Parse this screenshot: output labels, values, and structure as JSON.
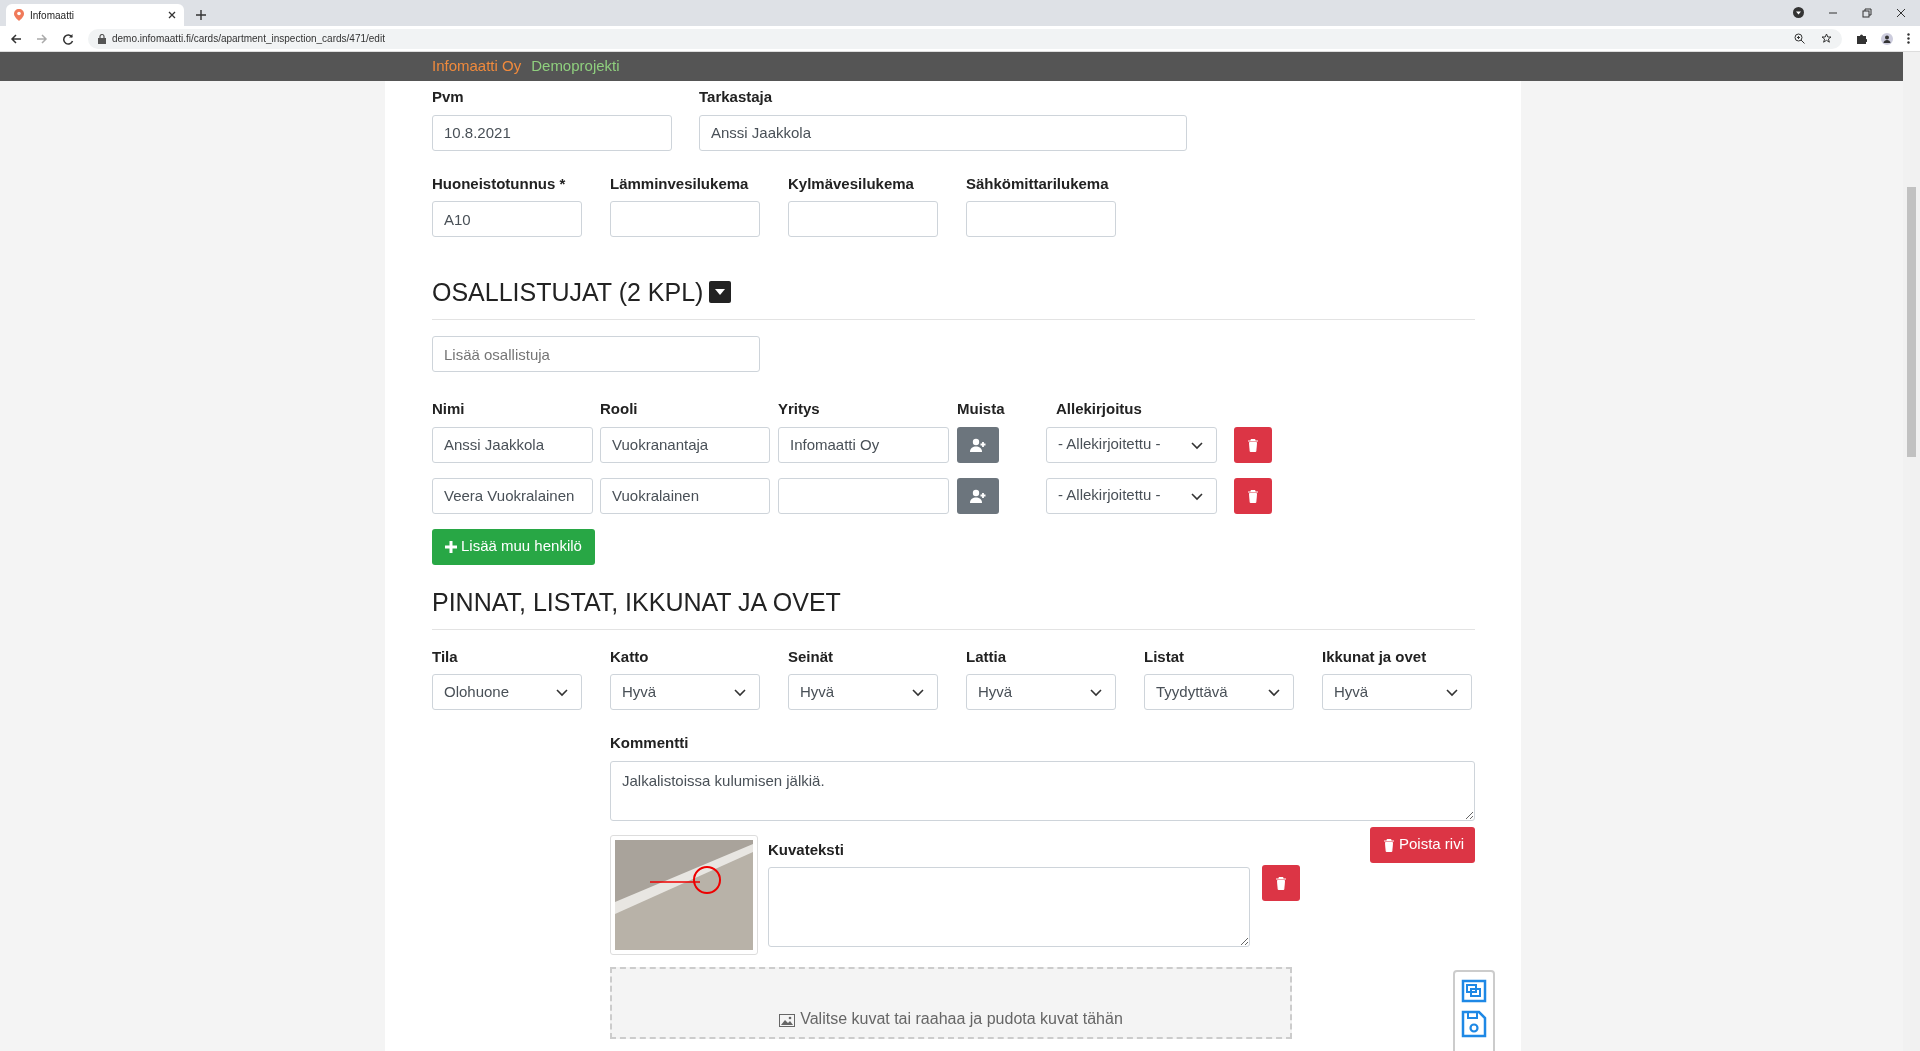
{
  "browser": {
    "tab_title": "Infomaatti",
    "url": "demo.infomaatti.fi/cards/apartment_inspection_cards/471/edit"
  },
  "header": {
    "company": "Infomaatti Oy",
    "project": "Demoprojekti"
  },
  "info_row_1": [
    {
      "label": "Pvm",
      "value": "10.8.2021"
    },
    {
      "label": "Tarkastaja",
      "value": "Anssi Jaakkola"
    }
  ],
  "info_row_2": [
    {
      "label": "Huoneistotunnus *",
      "value": "A10"
    },
    {
      "label": "Lämminvesilukema"
    },
    {
      "label": "Kylmävesilukema"
    },
    {
      "label": "Sähkömittarilukema"
    }
  ],
  "participants": {
    "title": "OSALLISTUJAT (2 KPL)",
    "expanded": true,
    "add_placeholder": "Lisää osallistuja",
    "columns": [
      "Nimi",
      "Rooli",
      "Yritys",
      "Muista",
      "Allekirjoitus"
    ],
    "rows": [
      {
        "name": "Anssi Jaakkola",
        "role": "Vuokranantaja",
        "company": "Infomaatti Oy",
        "signature": "- Allekirjoitettu -"
      },
      {
        "name": "Veera Vuokralainen",
        "role": "Vuokralainen",
        "signature": "- Allekirjoitettu -"
      }
    ],
    "add_button": "Lisää muu henkilö"
  },
  "surfaces": {
    "title": "PINNAT, LISTAT, IKKUNAT JA OVET",
    "fields": [
      {
        "label": "Tila",
        "value": "Olohuone"
      },
      {
        "label": "Katto",
        "value": "Hyvä"
      },
      {
        "label": "Seinät",
        "value": "Hyvä"
      },
      {
        "label": "Lattia",
        "value": "Hyvä"
      },
      {
        "label": "Listat",
        "value": "Tyydyttävä"
      },
      {
        "label": "Ikkunat ja ovet",
        "value": "Hyvä"
      }
    ],
    "comment_label": "Kommentti",
    "comment": "Jalkalistoissa kulumisen jälkiä.",
    "caption_label": "Kuvateksti",
    "delete_row_button": "Poista rivi",
    "dropzone_text": "Valitse kuvat tai raahaa ja pudota kuvat tähän"
  }
}
